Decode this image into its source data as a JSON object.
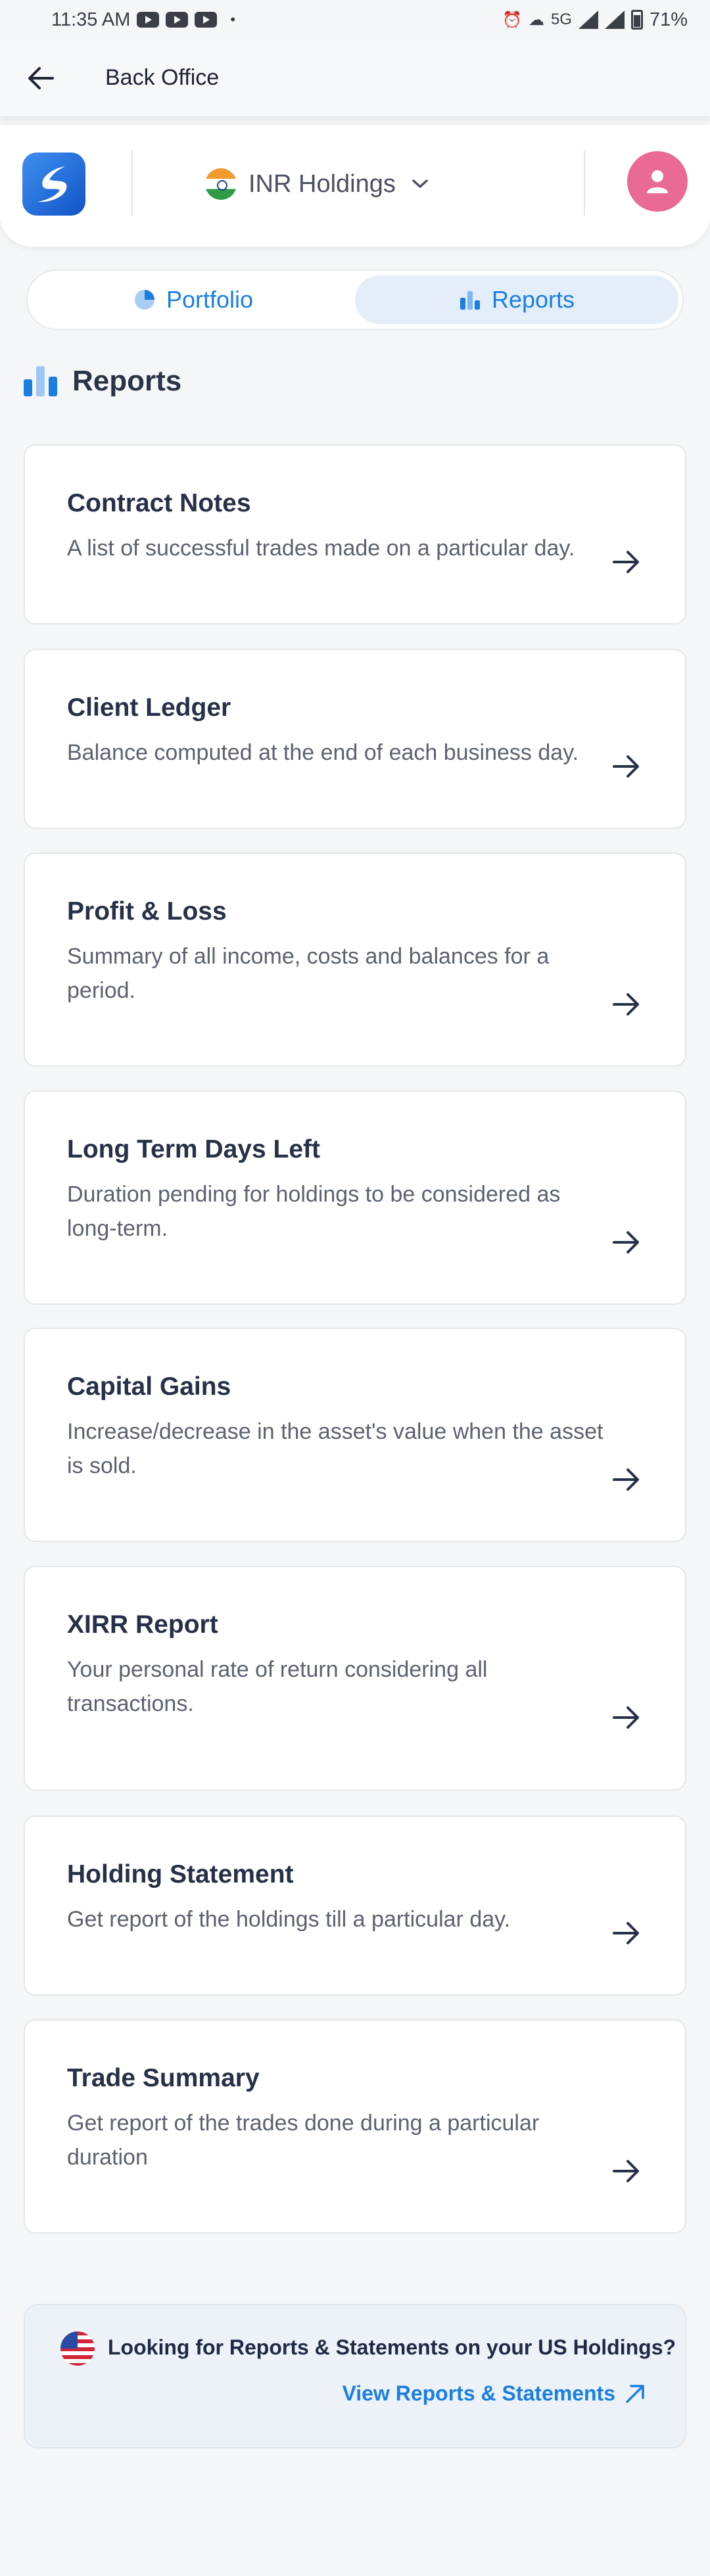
{
  "status_bar": {
    "time": "11:35 AM",
    "network": "5G",
    "battery": "71%"
  },
  "app_bar": {
    "title": "Back Office",
    "back_icon": "arrow-left-icon"
  },
  "header": {
    "holdings_label": "INR Holdings",
    "logo_icon": "app-logo-icon",
    "avatar_icon": "user-avatar-icon"
  },
  "tabs": [
    {
      "label": "Portfolio",
      "icon": "pie-chart-icon",
      "active": false
    },
    {
      "label": "Reports",
      "icon": "bar-chart-icon",
      "active": true
    }
  ],
  "section": {
    "title": "Reports"
  },
  "reports": [
    {
      "title": "Contract Notes",
      "description": "A list of successful trades made on a particular day."
    },
    {
      "title": "Client Ledger",
      "description": "Balance computed at the end of each business day."
    },
    {
      "title": "Profit & Loss",
      "description": "Summary of all income, costs and balances for a period."
    },
    {
      "title": "Long Term Days Left",
      "description": "Duration pending for holdings to be considered as long-term."
    },
    {
      "title": "Capital Gains",
      "description": "Increase/decrease in the asset's value when the asset is sold."
    },
    {
      "title": "XIRR Report",
      "description": "Your personal rate of return considering all transactions."
    },
    {
      "title": "Holding Statement",
      "description": "Get report of the holdings till a particular day."
    },
    {
      "title": "Trade Summary",
      "description": "Get report of the trades done during a particular duration"
    }
  ],
  "us_banner": {
    "text": "Looking for Reports & Statements on your US Holdings?",
    "link": "View Reports & Statements"
  },
  "colors": {
    "accent": "#1a7fe0",
    "avatar": "#e96a94",
    "text_primary": "#263148",
    "text_secondary": "#5b6270"
  }
}
